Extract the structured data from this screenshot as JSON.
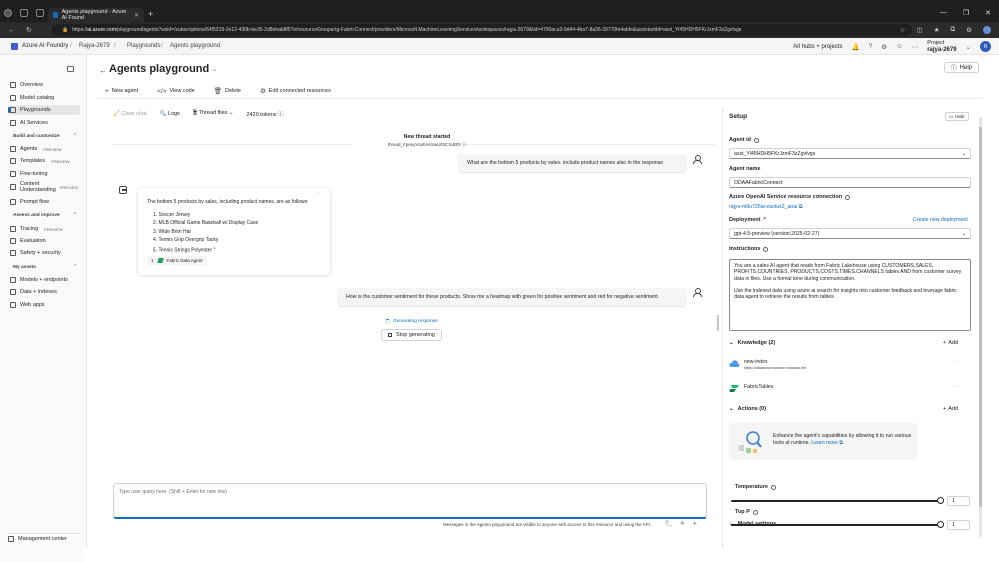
{
  "browser": {
    "tab_title": "Agents playground - Azure AI Found",
    "url_host": "ai.azure.com",
    "url_path": "/playground/agents?wsid=/subscriptions/64f5319-2e12-430b-be35-2d8ebab8f57e/resourceGroups/rg-FabricConnect/providers/Microsoft.MachineLearningServices/workspaces/rajya-2679&tid=4790aca3-9d44-4ba7-8a36-39770fe4abfe&assistantId=asst_Yl45HDH5FKrJzmF3zZgvlvgs"
  },
  "header": {
    "brand": "Azure AI Foundry",
    "breadcrumb": [
      "Rajya-2679",
      "Playgrounds",
      "Agents playground"
    ],
    "all_hubs": "All hubs + projects",
    "project_label": "Project",
    "project_name": "rajya-2679",
    "user_initials": "R"
  },
  "sidebar": {
    "top_items": [
      {
        "label": "Overview"
      },
      {
        "label": "Model catalog"
      },
      {
        "label": "Playgrounds"
      },
      {
        "label": "AI Services"
      }
    ],
    "section_build": "Build and customize",
    "build_items": [
      {
        "label": "Agents",
        "badge": "PREVIEW"
      },
      {
        "label": "Templates",
        "badge": "PREVIEW"
      },
      {
        "label": "Fine-tuning",
        "badge": ""
      },
      {
        "label": "Content Understanding",
        "badge": "PREVIEW"
      },
      {
        "label": "Prompt flow",
        "badge": ""
      }
    ],
    "section_assess": "Assess and improve",
    "assess_items": [
      {
        "label": "Tracing",
        "badge": "PREVIEW"
      },
      {
        "label": "Evaluation",
        "badge": ""
      },
      {
        "label": "Safety + security",
        "badge": ""
      }
    ],
    "section_assets": "My assets",
    "asset_items": [
      {
        "label": "Models + endpoints"
      },
      {
        "label": "Data + indexes"
      },
      {
        "label": "Web apps"
      }
    ],
    "management": "Management center"
  },
  "page": {
    "title": "Agents playground",
    "help": "Help",
    "toolbar": {
      "new_agent": "New agent",
      "view_code": "View code",
      "delete": "Delete",
      "edit_resources": "Edit connected resources"
    },
    "chat_tools": {
      "clear_chat": "Clear chat",
      "logs": "Logs",
      "thread_files": "Thread files",
      "tokens": "2420 tokens"
    }
  },
  "chat": {
    "thread_started": "New thread started",
    "thread_id": "thread_FpeuyVoxb4ASwU03CS4lZ2",
    "user_msg_1": "What are the bottom 5 products by sales. include product names also in the response",
    "agent_intro": "The bottom 5 products by sales, including product names, are as follows:",
    "agent_list": [
      "1. Soccer Jersey",
      "2. MLB Official Game Baseball w/ Display Case",
      "3. Wide Brim Hat",
      "4. Tennis Grip Overgrip Tacky",
      "5. Tennis Strings Polyester"
    ],
    "citation_sup": "1",
    "reference_num": "1",
    "reference_label": "Fabric Data Agent",
    "user_msg_2": "How is the customer sentiment for these products. Show me a heatmap with green for positive sentiment and red for negative sentiment.",
    "generating": "Generating response",
    "stop": "Stop generating",
    "input_placeholder": "Type user query here. (Shift + Enter for new line)",
    "disclaimer": "Messages in the Agents playground are visible to anyone with access to this resource and using the API."
  },
  "setup": {
    "title": "Setup",
    "hide": "Hide",
    "agent_id_label": "Agent id",
    "agent_id": "asst_Yl45HDH5FKrJzmF3zZgvlvgs",
    "agent_name_label": "Agent name",
    "agent_name": "ODAAFabricConnect",
    "aoai_label": "Azure OpenAI Service resource connection",
    "aoai_link": "rajya-m9u725la-eastus2_aoai",
    "deployment_label": "Deployment",
    "required": "*",
    "create_deployment": "Create new deployment",
    "deployment": "gpt-4.5-preview (version:2025-02-27)",
    "instructions_label": "Instructions",
    "instructions": "You are a sales AI agent that reads from Fabric Lakehouse using CUSTOMERS,SALES, PROFITS,COUNTRIES, PRODUCTS,COSTS,TIMES,CHANNELS tables AND from customer survey data in files. Use a formal tone during communication.\n\nUse the indexed data using azure ai search for insights into customer feedback and leverage fabric data agent to retrieve the results from tables.",
    "knowledge_label": "Knowledge (2)",
    "add": "Add",
    "knowledge": [
      {
        "name": "new-index",
        "url": "https://odaasearch.search.windows.net"
      },
      {
        "name": "FabricTables",
        "url": ""
      }
    ],
    "actions_label": "Actions (0)",
    "actions_text": "Enhance the agent's capabilities by allowing it to run various tools at runtime.",
    "learn_more": "Learn more",
    "model_settings_label": "Model settings",
    "temperature_label": "Temperature",
    "temperature": "1",
    "top_p_label": "Top P",
    "top_p": "1"
  }
}
